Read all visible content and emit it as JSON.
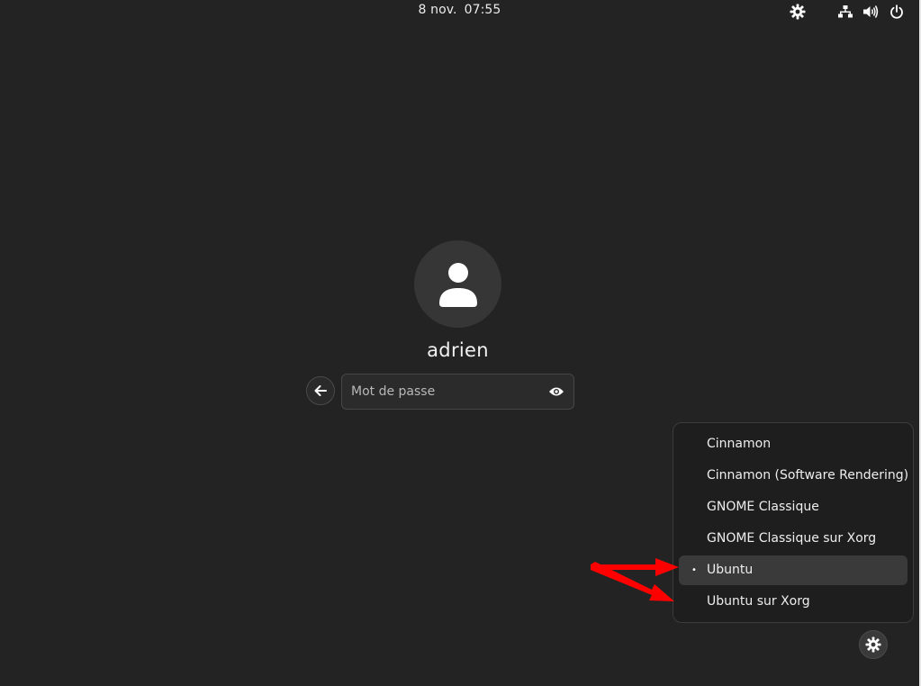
{
  "topbar": {
    "date": "8 nov.",
    "time": "07:55",
    "icons": [
      "accessibility-icon",
      "network-icon",
      "volume-icon",
      "power-icon"
    ]
  },
  "login": {
    "username": "adrien",
    "password_placeholder": "Mot de passe",
    "avatar_icon": "user-avatar-icon",
    "back_icon": "arrow-left-icon",
    "reveal_icon": "eye-icon"
  },
  "session_menu": {
    "items": [
      {
        "label": "Cinnamon",
        "selected": false
      },
      {
        "label": "Cinnamon (Software Rendering)",
        "selected": false
      },
      {
        "label": "GNOME Classique",
        "selected": false
      },
      {
        "label": "GNOME Classique sur Xorg",
        "selected": false
      },
      {
        "label": "Ubuntu",
        "selected": true
      },
      {
        "label": "Ubuntu sur Xorg",
        "selected": false
      }
    ],
    "selected_marker": "•",
    "button_icon": "gear-icon"
  },
  "annotation": {
    "color": "#ff0000",
    "icon": "red-arrow-icon"
  },
  "colors": {
    "background": "#232323",
    "menu_background": "#1e1e1e",
    "selected_item": "#3a3a3a"
  }
}
